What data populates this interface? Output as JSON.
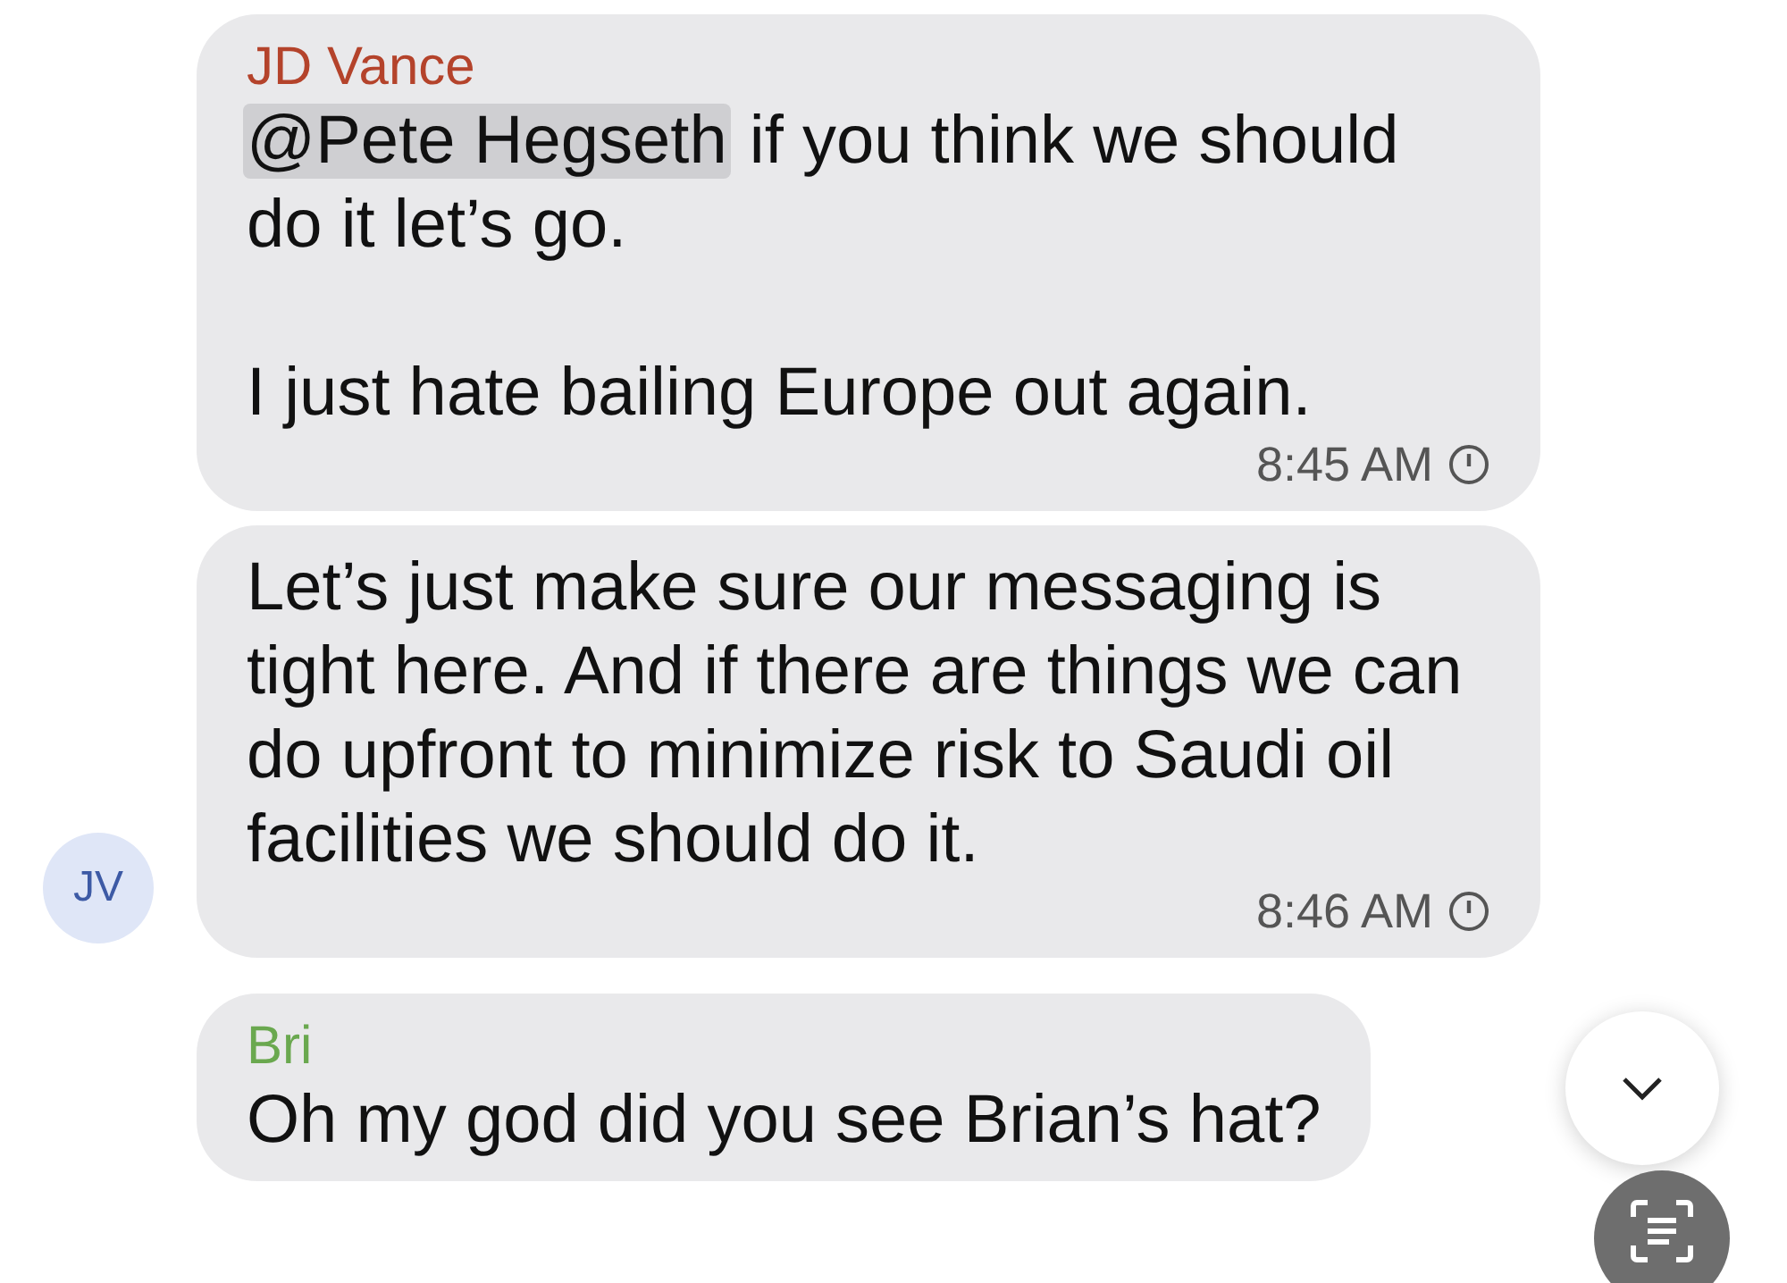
{
  "messages": [
    {
      "sender": "JD Vance",
      "color": "#b4432b",
      "mention": "@Pete Hegseth",
      "paragraphs": [
        "if you think we should do it let’s go.",
        "I just hate bailing Europe out again."
      ],
      "time": "8:45 AM"
    },
    {
      "avatar": "JV",
      "paragraphs": [
        "Let’s just make sure our messaging is tight here. And if there are things we can do upfront to minimize risk to Saudi oil facilities we should do it."
      ],
      "time": "8:46 AM"
    },
    {
      "sender": "Bri",
      "color": "#6aa84f",
      "paragraphs": [
        "Oh my god did you see Brian’s hat?"
      ]
    }
  ]
}
